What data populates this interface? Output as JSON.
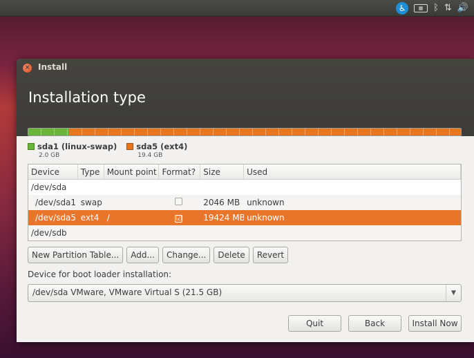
{
  "window": {
    "title": "Install",
    "heading": "Installation type"
  },
  "tray": {
    "network": "⇅",
    "bluetooth": "ᛒ",
    "volume": "🔊"
  },
  "partitions": [
    {
      "name": "sda1 (linux-swap)",
      "size": "2.0 GB",
      "color": "#6bb43a"
    },
    {
      "name": "sda5 (ext4)",
      "size": "19.4 GB",
      "color": "#e9761f"
    }
  ],
  "table": {
    "headers": [
      "Device",
      "Type",
      "Mount point",
      "Format?",
      "Size",
      "Used"
    ],
    "rows": [
      {
        "device": "/dev/sda",
        "type": "",
        "mount": "",
        "format": "",
        "size": "",
        "used": ""
      },
      {
        "device": "/dev/sda1",
        "type": "swap",
        "mount": "",
        "format": "",
        "size": "2046 MB",
        "used": "unknown"
      },
      {
        "device": "/dev/sda5",
        "type": "ext4",
        "mount": "/",
        "format": "☑",
        "size": "19424 MB",
        "used": "unknown"
      },
      {
        "device": "/dev/sdb",
        "type": "",
        "mount": "",
        "format": "",
        "size": "",
        "used": ""
      }
    ]
  },
  "buttons": {
    "new_table": "New Partition Table...",
    "add": "Add...",
    "change": "Change...",
    "delete": "Delete",
    "revert": "Revert"
  },
  "bootloader": {
    "label": "Device for boot loader installation:",
    "value": "/dev/sda   VMware, VMware Virtual S (21.5 GB)"
  },
  "footer": {
    "quit": "Quit",
    "back": "Back",
    "install": "Install Now"
  }
}
